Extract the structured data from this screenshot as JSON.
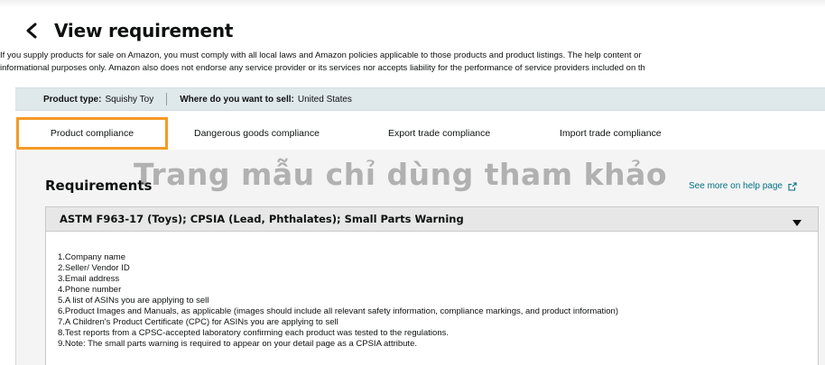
{
  "header": {
    "title": "View requirement"
  },
  "disclaimer": {
    "line1": "If you supply products for sale on Amazon, you must comply with all local laws and Amazon policies applicable to those products and product listings. The help content or",
    "line2": "informational purposes only. Amazon also does not endorse any service provider or its services nor accepts liability for the performance of service providers included on th"
  },
  "meta": {
    "product_type_label": "Product type:",
    "product_type_value": "Squishy Toy",
    "sell_label": "Where do you want to sell:",
    "sell_value": "United States"
  },
  "tabs": [
    {
      "label": "Product compliance",
      "active": true
    },
    {
      "label": "Dangerous goods compliance",
      "active": false
    },
    {
      "label": "Export trade compliance",
      "active": false
    },
    {
      "label": "Import trade compliance",
      "active": false
    }
  ],
  "watermark": "Trang mẫu chỉ dùng tham khảo",
  "requirements": {
    "title": "Requirements",
    "help_link": "See more on help page",
    "accordion_title": "ASTM F963-17 (Toys); CPSIA (Lead, Phthalates); Small Parts Warning",
    "items": [
      "1.Company name",
      "2.Seller/ Vendor ID",
      "3.Email address",
      "4.Phone number",
      "5.A list of ASINs you are applying to sell",
      "6.Product Images and Manuals, as applicable (images should include all relevant safety information, compliance markings, and product information)",
      "7.A Children's Product Certificate (CPC) for ASINs you are applying to sell",
      "8.Test reports from a CPSC-accepted laboratory confirming each product was tested to the regulations.",
      "9.Note: The small parts warning is required to appear on your detail page as a CPSIA attribute."
    ]
  },
  "colors": {
    "accent_orange": "#f49a25",
    "link_teal": "#007185",
    "meta_bar_bg": "#dfe8eb"
  },
  "icons": {
    "back": "chevron-left-icon",
    "external": "external-link-icon",
    "caret": "caret-down-icon"
  }
}
